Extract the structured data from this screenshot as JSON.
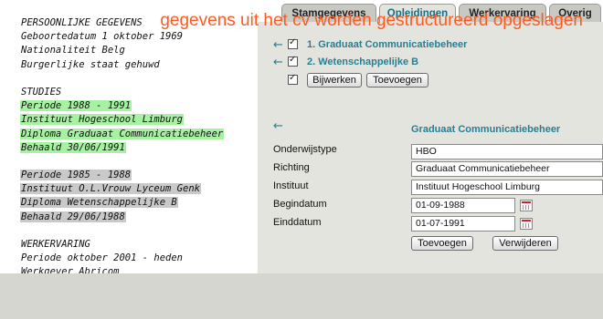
{
  "cv": {
    "personal_heading": "PERSOONLIJKE GEGEVENS",
    "birth": "Geboortedatum 1 oktober 1969",
    "nationality": "Nationaliteit Belg",
    "civil_status": "Burgerlijke staat gehuwd",
    "studies_heading": "STUDIES",
    "study1": [
      "Periode 1988 - 1991",
      "Instituut Hogeschool Limburg",
      "Diploma Graduaat Communicatiebeheer",
      "Behaald 30/06/1991"
    ],
    "study2": [
      "Periode 1985 - 1988",
      "Instituut O.L.Vrouw Lyceum Genk",
      "Diploma Wetenschappelijke B",
      "Behaald 29/06/1988"
    ],
    "work_heading": "WERKERVARING",
    "work": [
      "Periode oktober 2001 - heden",
      "Werkgever Abricom"
    ],
    "colors": {
      "highlight_selected": "#a6f2a2",
      "highlight_other": "#c9c9c9"
    }
  },
  "tabs": [
    {
      "label": "Stamgegevens",
      "active": false
    },
    {
      "label": "Opleidingen",
      "active": true
    },
    {
      "label": "Werkervaring",
      "active": false
    },
    {
      "label": "Overig",
      "active": false
    }
  ],
  "opleidingen": {
    "items": [
      {
        "label": "1. Graduaat Communicatiebeheer",
        "checked": true,
        "icon": "arrow-left-icon"
      },
      {
        "label": "2. Wetenschappelijke B",
        "checked": true,
        "icon": "arrow-left-icon"
      }
    ],
    "update_button": "Bijwerken",
    "add_button": "Toevoegen"
  },
  "detail": {
    "title": "Graduaat Communicatiebeheer",
    "fields": {
      "onderwijstype": {
        "label": "Onderwijstype",
        "value": "HBO"
      },
      "richting": {
        "label": "Richting",
        "value": "Graduaat Communicatiebeheer"
      },
      "instituut": {
        "label": "Instituut",
        "value": "Instituut Hogeschool Limburg"
      },
      "begindatum": {
        "label": "Begindatum",
        "value": "01-09-1988"
      },
      "einddatum": {
        "label": "Einddatum",
        "value": "01-07-1991"
      }
    },
    "add_button": "Toevoegen",
    "delete_button": "Verwijderen"
  },
  "caption": "gegevens uit het cv worden gestructureerd opgeslagen",
  "colors": {
    "accent": "#2a7e92",
    "caption": "#ff5a1f",
    "panel": "#e4e4de"
  }
}
